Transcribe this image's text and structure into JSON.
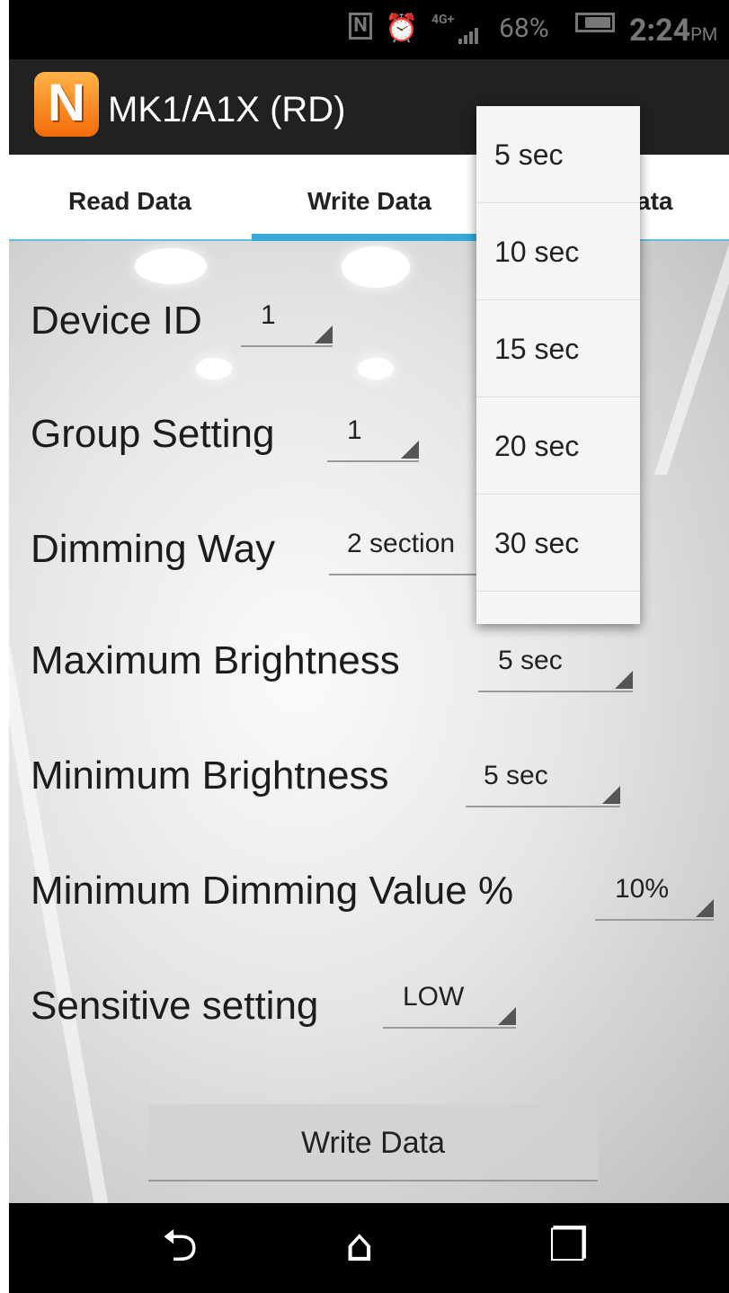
{
  "status_bar": {
    "nfc_label": "N",
    "network": "4G+",
    "battery_percent": "68%",
    "time": "2:24",
    "ampm": "PM"
  },
  "app_bar": {
    "logo_letter": "N",
    "title": "MK1/A1X (RD)"
  },
  "tabs": [
    {
      "label": "Read Data"
    },
    {
      "label": "Write Data"
    },
    {
      "label": "ata"
    }
  ],
  "form": {
    "device_id": {
      "label": "Device ID",
      "value": "1"
    },
    "group_setting": {
      "label": "Group Setting",
      "value": "1"
    },
    "dimming_way": {
      "label": "Dimming Way",
      "value": "2 section"
    },
    "max_brightness": {
      "label": "Maximum Brightness",
      "value": "5 sec"
    },
    "min_brightness": {
      "label": "Minimum Brightness",
      "value": "5 sec"
    },
    "min_dimming": {
      "label": "Minimum Dimming Value %",
      "value": "10%"
    },
    "sensitive": {
      "label": "Sensitive setting",
      "value": "LOW"
    }
  },
  "write_button": "Write Data",
  "dropdown": {
    "options": [
      "5 sec",
      "10 sec",
      "15 sec",
      "20 sec",
      "30 sec"
    ]
  },
  "nav": {
    "back_icon": "back-icon",
    "home_icon": "home-icon",
    "recent_icon": "recent-apps-icon"
  }
}
